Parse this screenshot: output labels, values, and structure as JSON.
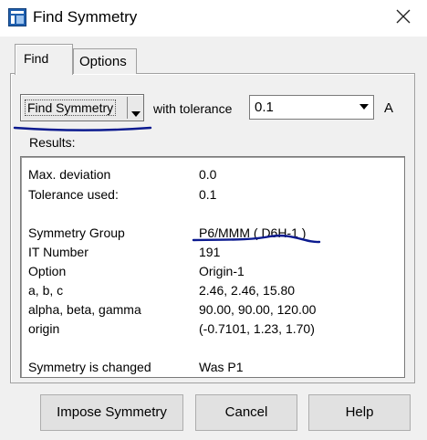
{
  "window": {
    "title": "Find Symmetry"
  },
  "tabs": [
    {
      "label": "Find",
      "selected": true
    },
    {
      "label": "Options",
      "selected": false
    }
  ],
  "find": {
    "button_label": "Find Symmetry",
    "tolerance_label": "with tolerance",
    "tolerance_value": "0.1",
    "unit": "A"
  },
  "results": {
    "label": "Results:",
    "rows": [
      {
        "label": "Max. deviation",
        "value": "0.0"
      },
      {
        "label": "Tolerance used:",
        "value": "0.1"
      },
      {
        "label": "Symmetry Group",
        "value": "P6/MMM ( D6H-1 )"
      },
      {
        "label": "IT Number",
        "value": "191"
      },
      {
        "label": "Option",
        "value": "Origin-1"
      },
      {
        "label": "a, b, c",
        "value": "2.46,  2.46,  15.80"
      },
      {
        "label": "alpha, beta, gamma",
        "value": "90.00,  90.00,  120.00"
      },
      {
        "label": "origin",
        "value": "(-0.7101,  1.23,  1.70)"
      },
      {
        "label": "Symmetry is changed",
        "value": "Was P1"
      }
    ]
  },
  "buttons": {
    "impose": "Impose Symmetry",
    "cancel": "Cancel",
    "help": "Help"
  },
  "colors": {
    "annotation_ink": "#0b1a8f",
    "dialog_bg": "#f0f0f0"
  }
}
